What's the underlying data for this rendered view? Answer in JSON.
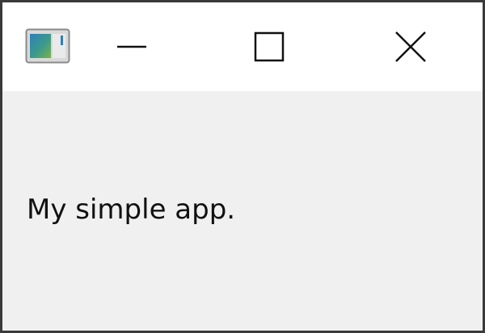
{
  "window": {
    "icon": "application-window-icon",
    "controls": {
      "minimize_icon": "minimize-icon",
      "maximize_icon": "maximize-icon",
      "close_icon": "close-icon"
    }
  },
  "content": {
    "label": "My simple app."
  },
  "colors": {
    "titlebar": "#ffffff",
    "client_area": "#f0f0f0",
    "border": "#3a3a3a",
    "icon_stroke": "#111111"
  }
}
